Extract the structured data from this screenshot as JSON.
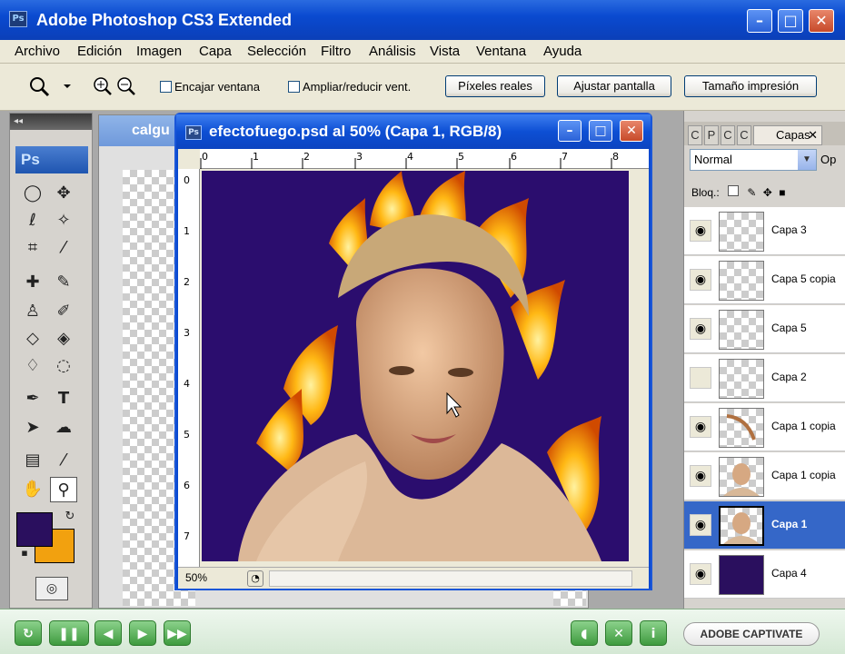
{
  "window": {
    "title": "Adobe Photoshop CS3 Extended",
    "app_badge": "Ps"
  },
  "menu": [
    "Archivo",
    "Edición",
    "Imagen",
    "Capa",
    "Selección",
    "Filtro",
    "Análisis",
    "Vista",
    "Ventana",
    "Ayuda"
  ],
  "options": {
    "checkbox_fit": "Encajar ventana",
    "checkbox_zoom": "Ampliar/reducir vent.",
    "btn_actual": "Píxeles reales",
    "btn_fit": "Ajustar pantalla",
    "btn_print": "Tamaño impresión"
  },
  "tools": {
    "badge": "Ps",
    "foreground_color": "#2a0f5e",
    "background_color": "#f2a10f"
  },
  "back_document": {
    "title": "calgu"
  },
  "document": {
    "title": "efectofuego.psd al 50% (Capa 1, RGB/8)",
    "zoom": "50%",
    "ruler_top": [
      "0",
      "1",
      "2",
      "3",
      "4",
      "5",
      "6",
      "7",
      "8"
    ],
    "ruler_left": [
      "0",
      "1",
      "2",
      "3",
      "4",
      "5",
      "6",
      "7"
    ]
  },
  "layers_panel": {
    "tabs": [
      "C",
      "P",
      "C",
      "C",
      "Capas"
    ],
    "blend_mode": "Normal",
    "opacity_label": "Op",
    "lock_label": "Bloq.:",
    "layers": [
      {
        "name": "Capa 3",
        "visible": true,
        "selected": false,
        "thumb": "transparent"
      },
      {
        "name": "Capa 5 copia",
        "visible": true,
        "selected": false,
        "thumb": "transparent"
      },
      {
        "name": "Capa 5",
        "visible": true,
        "selected": false,
        "thumb": "transparent"
      },
      {
        "name": "Capa 2",
        "visible": false,
        "selected": false,
        "thumb": "transparent"
      },
      {
        "name": "Capa 1 copia",
        "visible": true,
        "selected": false,
        "thumb": "stroke"
      },
      {
        "name": "Capa 1 copia",
        "visible": true,
        "selected": false,
        "thumb": "portrait"
      },
      {
        "name": "Capa 1",
        "visible": true,
        "selected": true,
        "thumb": "portrait"
      },
      {
        "name": "Capa 4",
        "visible": true,
        "selected": false,
        "thumb": "#2a0f5e"
      }
    ]
  },
  "captivate": {
    "logo": "ADOBE CAPTIVATE"
  }
}
